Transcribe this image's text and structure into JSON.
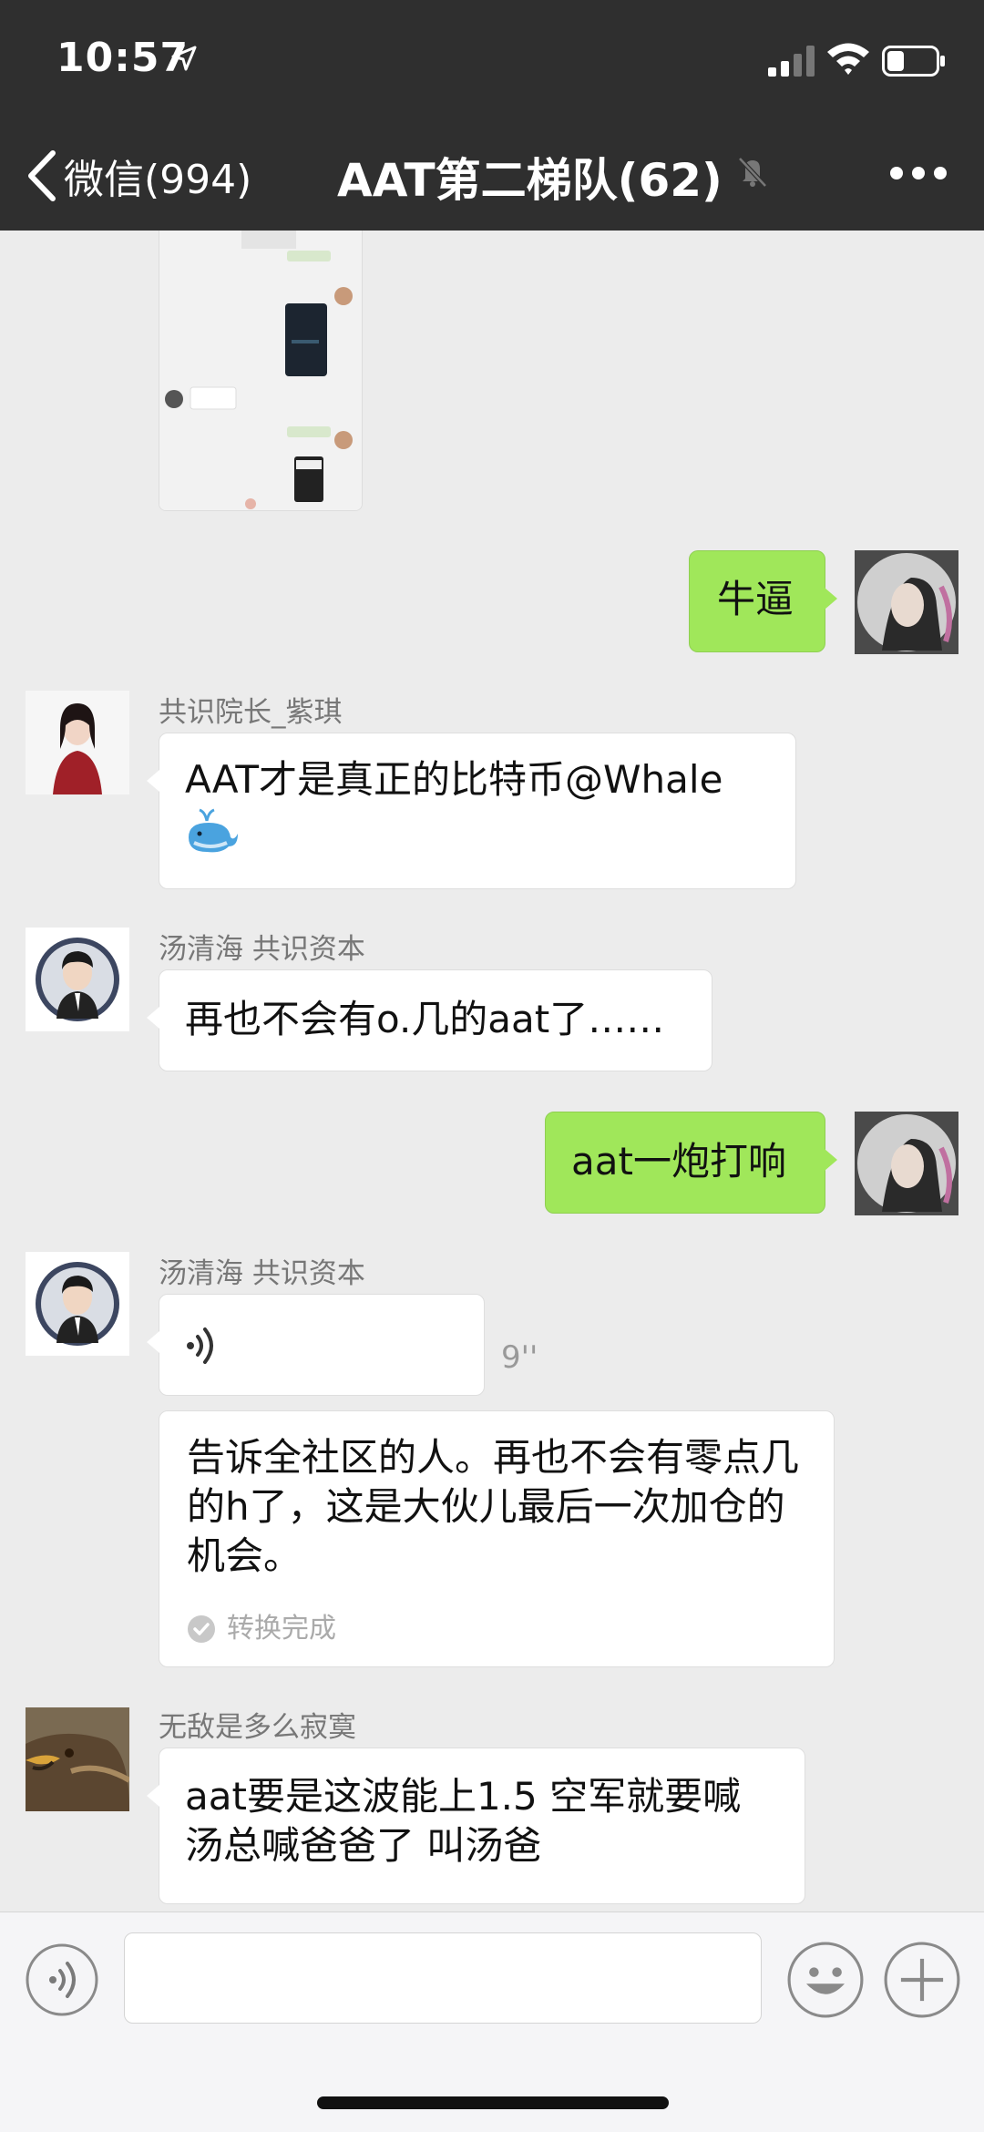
{
  "status_bar": {
    "time": "10:57"
  },
  "header": {
    "back_label": "微信(994)",
    "title": "AAT第二梯队(62)"
  },
  "messages": [
    {
      "id": "m1",
      "side": "right",
      "text": "牛逼"
    },
    {
      "id": "m2",
      "side": "left",
      "sender": "共识院长_紫琪",
      "text": "AAT才是真正的比特币@Whale"
    },
    {
      "id": "m3",
      "side": "left",
      "sender": "汤清海  共识资本",
      "text": "再也不会有o.几的aat了……"
    },
    {
      "id": "m4",
      "side": "right",
      "text": "aat一炮打响"
    },
    {
      "id": "m5",
      "side": "left",
      "sender": "汤清海  共识资本",
      "voice_duration": "9''",
      "transcription": "告诉全社区的人。再也不会有零点几的h了，这是大伙儿最后一次加仓的机会。",
      "transcription_status": "转换完成"
    },
    {
      "id": "m6",
      "side": "left",
      "sender": "无敌是多么寂寞",
      "text": "aat要是这波能上1.5 空军就要喊汤总喊爸爸了    叫汤爸"
    }
  ],
  "icons": {
    "back": "chevron-left-icon",
    "mute": "mute-bell-icon",
    "more": "more-dots-icon",
    "voice": "voice-icon",
    "emoji": "emoji-icon",
    "add": "plus-icon"
  },
  "colors": {
    "header_bg": "#2f2f2f",
    "chat_bg": "#ececec",
    "self_bubble": "#a0e75a",
    "other_bubble": "#ffffff"
  }
}
